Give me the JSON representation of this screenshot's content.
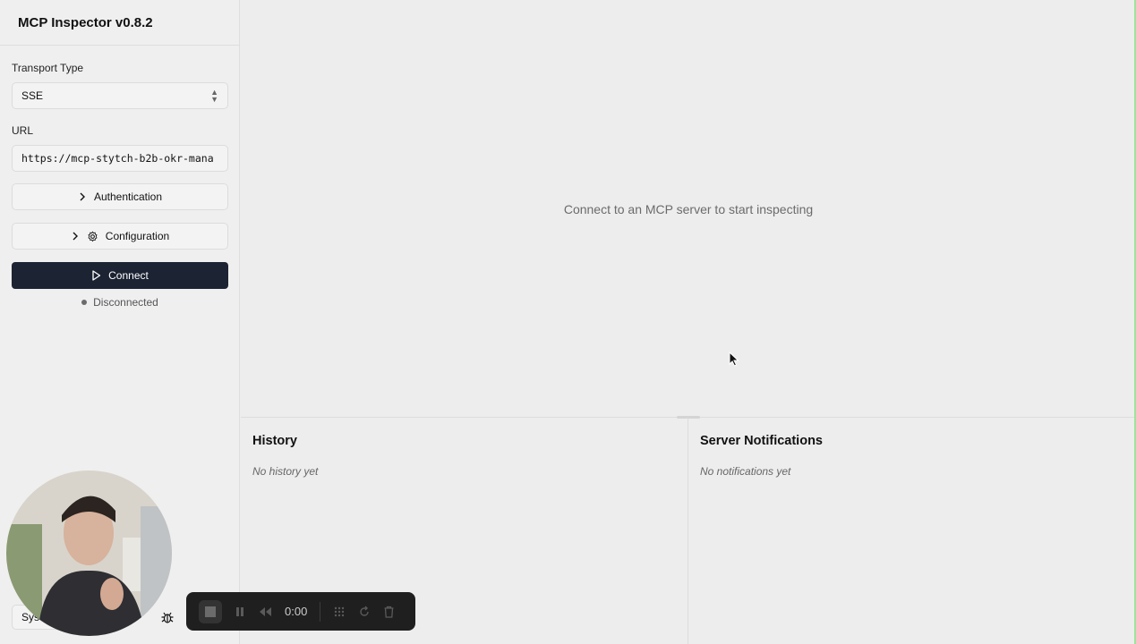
{
  "app": {
    "title": "MCP Inspector v0.8.2"
  },
  "sidebar": {
    "transport_label": "Transport Type",
    "transport_value": "SSE",
    "url_label": "URL",
    "url_value": "https://mcp-stytch-b2b-okr-mana",
    "authentication_label": "Authentication",
    "configuration_label": "Configuration",
    "connect_label": "Connect",
    "status_text": "Disconnected",
    "bottom_select_value": "Sys"
  },
  "main": {
    "empty_message": "Connect to an MCP server to start inspecting"
  },
  "history": {
    "title": "History",
    "empty": "No history yet"
  },
  "notifications": {
    "title": "Server Notifications",
    "empty": "No notifications yet"
  },
  "recorder": {
    "time": "0:00"
  },
  "colors": {
    "primary_button": "#1c2333",
    "status_dot": "#6b6b6b",
    "background": "#ededed"
  },
  "icons": [
    "chevron-updown-icon",
    "chevron-right-icon",
    "gear-icon",
    "play-icon",
    "bug-icon",
    "stop-icon",
    "pause-icon",
    "rewind-icon",
    "grid-icon",
    "restart-icon",
    "trash-icon",
    "cursor-icon"
  ]
}
